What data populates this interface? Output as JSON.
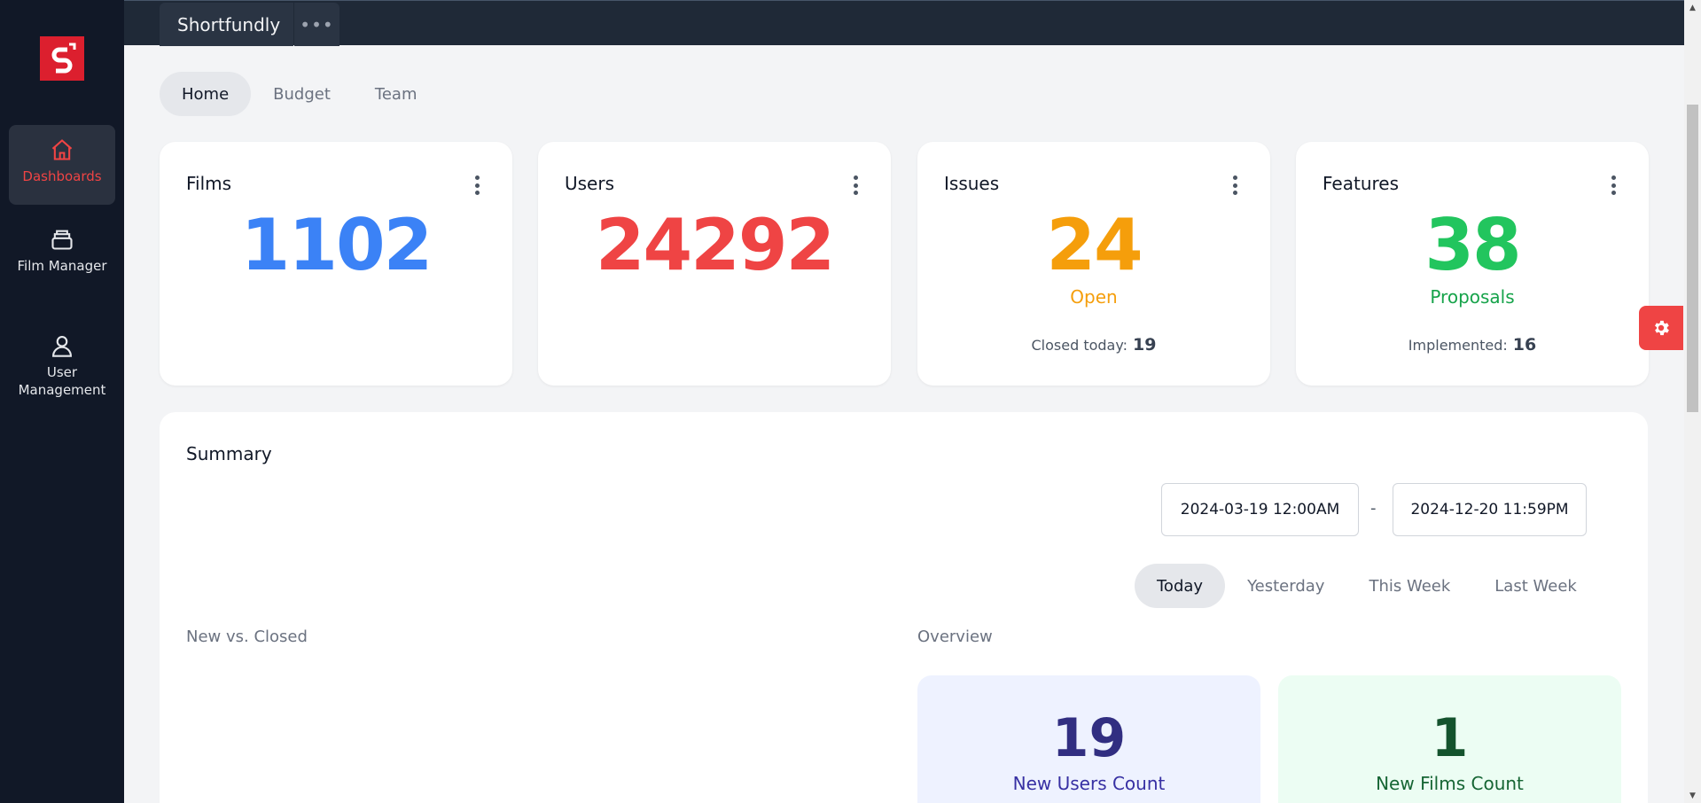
{
  "colors": {
    "sidebar_bg": "#111827",
    "topbar_bg": "#1f2937",
    "accent_red": "#ef4444",
    "blue": "#3b82f6",
    "orange": "#f59e0b",
    "green": "#22c55e"
  },
  "logo": {
    "letter": "S",
    "icon": "brand-logo"
  },
  "sidebar": {
    "items": [
      {
        "label": "Dashboards",
        "icon": "home-icon",
        "active": true
      },
      {
        "label": "Film Manager",
        "icon": "archive-box-icon",
        "active": false
      },
      {
        "label": "User Management",
        "icon": "user-icon",
        "active": false
      }
    ]
  },
  "topbar": {
    "app_name": "Shortfundly",
    "more_label": "•••"
  },
  "subtabs": [
    {
      "label": "Home",
      "active": true
    },
    {
      "label": "Budget",
      "active": false
    },
    {
      "label": "Team",
      "active": false
    }
  ],
  "cards": {
    "films": {
      "title": "Films",
      "value": "1102"
    },
    "users": {
      "title": "Users",
      "value": "24292"
    },
    "issues": {
      "title": "Issues",
      "value": "24",
      "sub": "Open",
      "foot_label": "Closed today:",
      "foot_value": "19"
    },
    "features": {
      "title": "Features",
      "value": "38",
      "sub": "Proposals",
      "foot_label": "Implemented:",
      "foot_value": "16"
    }
  },
  "summary": {
    "title": "Summary",
    "date_start": "2024-03-19  12:00AM",
    "date_separator": "-",
    "date_end": "2024-12-20  11:59PM",
    "ranges": [
      {
        "label": "Today",
        "active": true
      },
      {
        "label": "Yesterday",
        "active": false
      },
      {
        "label": "This Week",
        "active": false
      },
      {
        "label": "Last Week",
        "active": false
      }
    ],
    "left_section": "New vs. Closed",
    "right_section": "Overview",
    "overview": {
      "new_users": {
        "value": "19",
        "label": "New Users Count"
      },
      "new_films": {
        "value": "1",
        "label": "New Films Count"
      }
    }
  }
}
